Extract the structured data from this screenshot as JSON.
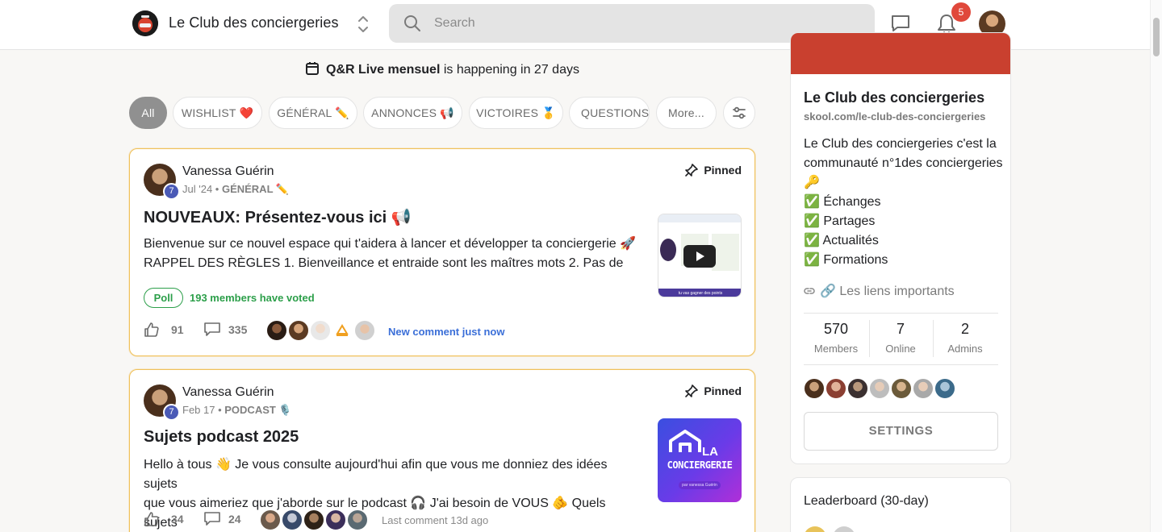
{
  "header": {
    "club_name": "Le Club des conciergeries",
    "search_placeholder": "Search",
    "notification_count": "5"
  },
  "event": {
    "name": "Q&R Live mensuel",
    "suffix": "is happening in 27 days"
  },
  "chips": [
    {
      "label": "All",
      "active": true
    },
    {
      "label": "WISHLIST ❤️"
    },
    {
      "label": "GÉNÉRAL ✏️"
    },
    {
      "label": "ANNONCES 📢"
    },
    {
      "label": "VICTOIRES 🥇"
    },
    {
      "label": "QUESTIONS"
    },
    {
      "label": "More..."
    }
  ],
  "posts": [
    {
      "author": "Vanessa Guérin",
      "level": "7",
      "date": "Jul '24",
      "category": "GÉNÉRAL ✏️",
      "pinned_label": "Pinned",
      "title": "NOUVEAUX: Présentez-vous ici 📢",
      "body_line1": "Bienvenue sur ce nouvel espace qui t'aidera à lancer et développer ta conciergerie 🚀",
      "body_line2": "RAPPEL DES RÈGLES 1. Bienveillance et entraide sont les maîtres mots 2. Pas de",
      "poll_label": "Poll",
      "poll_text": "193 members have voted",
      "likes": "91",
      "comments": "335",
      "activity": "New comment just now",
      "thumb_caption": "tu vas gagner des points"
    },
    {
      "author": "Vanessa Guérin",
      "level": "7",
      "date": "Feb 17",
      "category": "PODCAST 🎙️",
      "pinned_label": "Pinned",
      "title": "Sujets podcast 2025",
      "body_line1": "Hello à tous 👋 Je vous consulte aujourd'hui afin que vous me donniez des idées sujets",
      "body_line2": "que vous aimeriez que j'aborde sur le podcast 🎧 J'ai besoin de VOUS 🫵 Quels sujets",
      "likes": "34",
      "comments": "24",
      "activity": "Last comment 13d ago",
      "thumb_line1": "LA",
      "thumb_line2": "CONCIERGERIE",
      "thumb_line3": "par vanessa Guérin"
    }
  ],
  "sidebar": {
    "name": "Le Club des conciergeries",
    "url": "skool.com/le-club-des-conciergeries",
    "desc_1": "Le Club des conciergeries c'est la communauté n°1des conciergeries 🔑",
    "desc_2": "✅ Échanges",
    "desc_3": "✅ Partages",
    "desc_4": "✅ Actualités",
    "desc_5": "✅ Formations",
    "link_label": "🔗 Les liens importants",
    "stats": [
      {
        "value": "570",
        "label": "Members"
      },
      {
        "value": "7",
        "label": "Online"
      },
      {
        "value": "2",
        "label": "Admins"
      }
    ],
    "settings_label": "SETTINGS",
    "leaderboard_title": "Leaderboard (30-day)"
  },
  "colors": {
    "accent_cover": "#c9402f",
    "pinned_border": "#f0c15a",
    "poll_green": "#2c9f4a",
    "link_blue": "#3b6fd8",
    "badge_red": "#e0483b"
  }
}
